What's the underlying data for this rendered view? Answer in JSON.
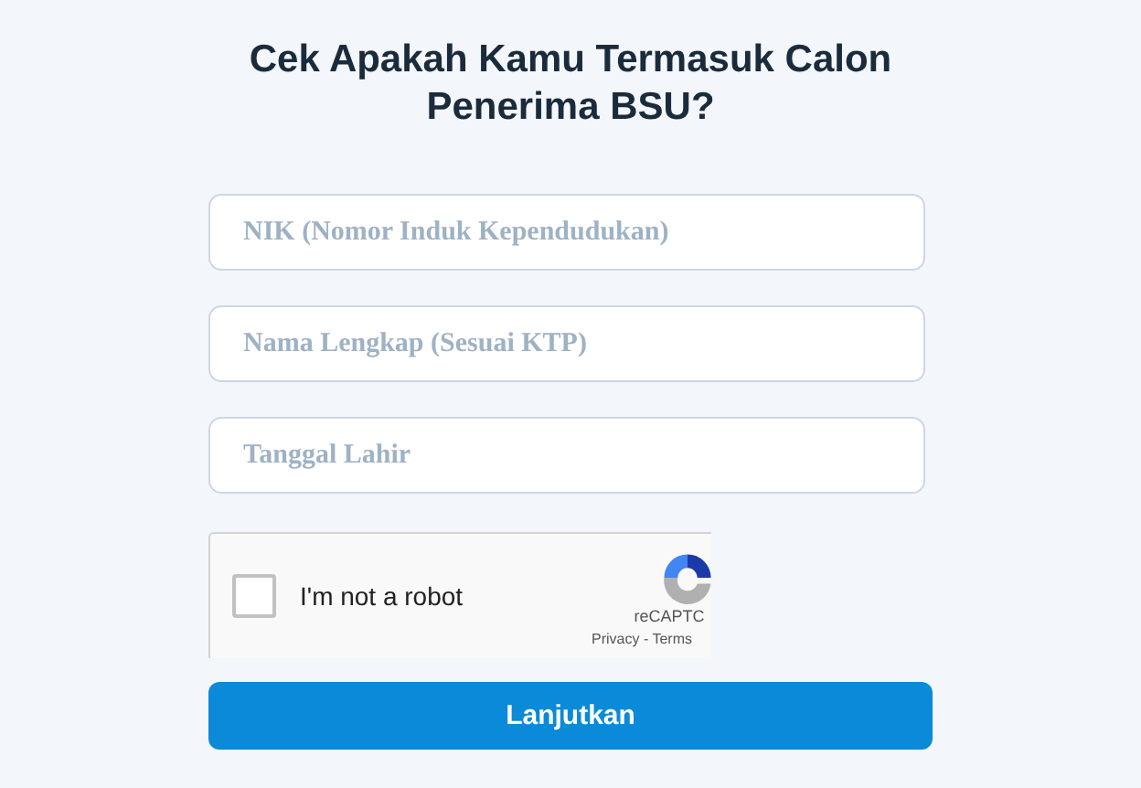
{
  "title": "Cek Apakah Kamu Termasuk Calon Penerima BSU?",
  "fields": [
    {
      "placeholder": "NIK (Nomor Induk Kependudukan)"
    },
    {
      "placeholder": "Nama Lengkap (Sesuai KTP)"
    },
    {
      "placeholder": "Tanggal Lahir"
    }
  ],
  "captcha": {
    "label": "I'm not a robot",
    "checked": false,
    "brand": "reCAPTC",
    "privacy": "Privacy",
    "separator": "-",
    "terms": "Terms"
  },
  "submit_button": "Lanjutkan"
}
